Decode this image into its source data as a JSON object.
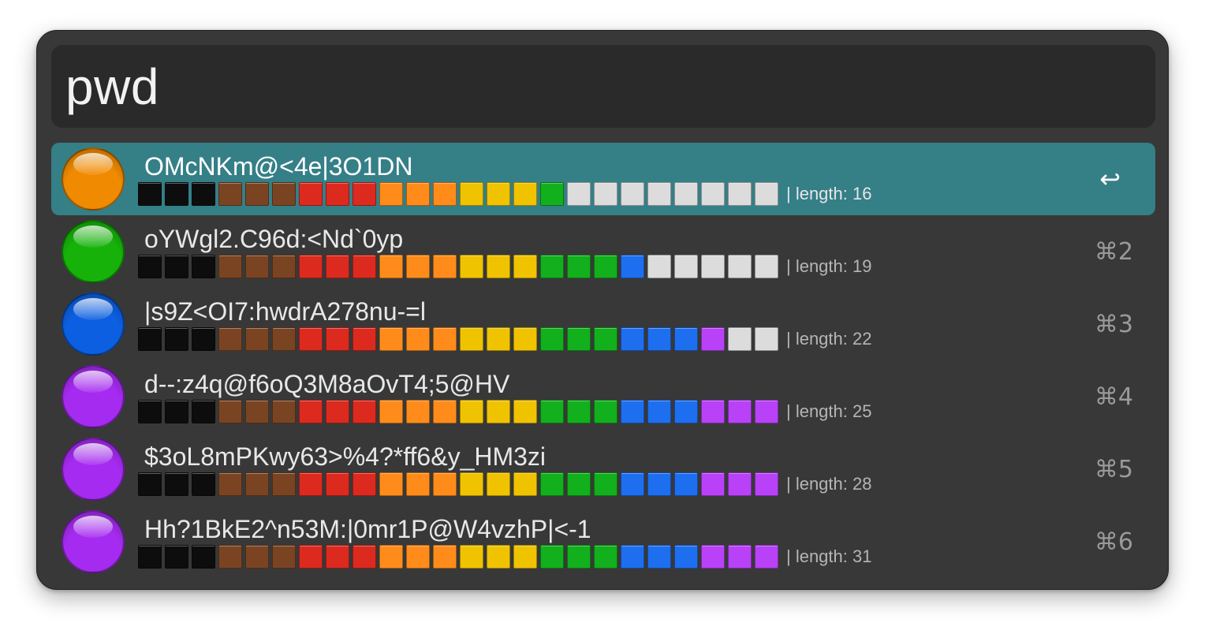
{
  "search": {
    "query": "pwd"
  },
  "colors": {
    "window_bg": "#383838",
    "search_bg": "#2a2a2a",
    "selected_bg": "#357f87",
    "segment_colors": {
      "black": "#0d0d0d",
      "brown": "#7a4423",
      "red": "#dc2a1f",
      "orange": "#ff8c1a",
      "yellow": "#f0c300",
      "green": "#12b01c",
      "blue": "#1e6ff0",
      "purple": "#b941f7",
      "empty": "#dcdcdc"
    },
    "orb_colors": {
      "orange": "#f08a00",
      "green": "#16b20a",
      "blue": "#0b5fe0",
      "purple": "#a52bf0"
    }
  },
  "results": [
    {
      "password": "OMcNKm@<4e|3O1DN",
      "length_label": "| length: 16",
      "length": 16,
      "strength_color": "orange",
      "shortcut": "↩",
      "selected": true,
      "strength_icon": "orange-circle-icon"
    },
    {
      "password": "oYWgl2.C96d:<Nd`0yp",
      "length_label": "| length: 19",
      "length": 19,
      "strength_color": "green",
      "shortcut": "⌘2",
      "selected": false,
      "strength_icon": "green-circle-icon"
    },
    {
      "password": "|s9Z<OI7:hwdrA278nu-=l",
      "length_label": "| length: 22",
      "length": 22,
      "strength_color": "blue",
      "shortcut": "⌘3",
      "selected": false,
      "strength_icon": "blue-circle-icon"
    },
    {
      "password": "d--:z4q@f6oQ3M8aOvT4;5@HV",
      "length_label": "| length: 25",
      "length": 25,
      "strength_color": "purple",
      "shortcut": "⌘4",
      "selected": false,
      "strength_icon": "purple-circle-icon"
    },
    {
      "password": "$3oL8mPKwy63>%4?*ff6&y_HM3zi",
      "length_label": "| length: 28",
      "length": 28,
      "strength_color": "purple",
      "shortcut": "⌘5",
      "selected": false,
      "strength_icon": "purple-circle-icon"
    },
    {
      "password": "Hh?1BkE2^n53M:|0mr1P@W4vzhP|<-1",
      "length_label": "| length: 31",
      "length": 31,
      "strength_color": "purple",
      "shortcut": "⌘6",
      "selected": false,
      "strength_icon": "purple-circle-icon"
    }
  ]
}
